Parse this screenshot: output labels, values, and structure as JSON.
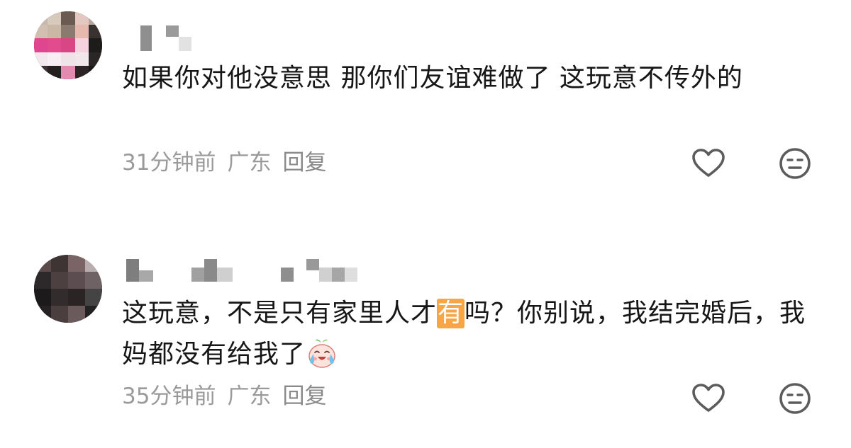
{
  "comments": [
    {
      "text": "如果你对他没意思 那你们友谊难做了 这玩意不传外的",
      "time": "31分钟前",
      "location": "广东",
      "reply_label": "回复"
    },
    {
      "text_before": "这玩意，不是只有家里人才",
      "highlight": "有",
      "text_after": "吗？你别说，我结完婚后，我妈都没有给我了",
      "emoji": "crying-laughing-peach-emoji",
      "time": "35分钟前",
      "location": "广东",
      "reply_label": "回复"
    }
  ],
  "icons": {
    "like": "heart-outline-icon",
    "dislike": "neutral-face-icon"
  },
  "colors": {
    "text": "#161616",
    "meta": "#9a9a9a",
    "highlight_bg": "#f7a545",
    "icon": "#5c5c5c"
  }
}
